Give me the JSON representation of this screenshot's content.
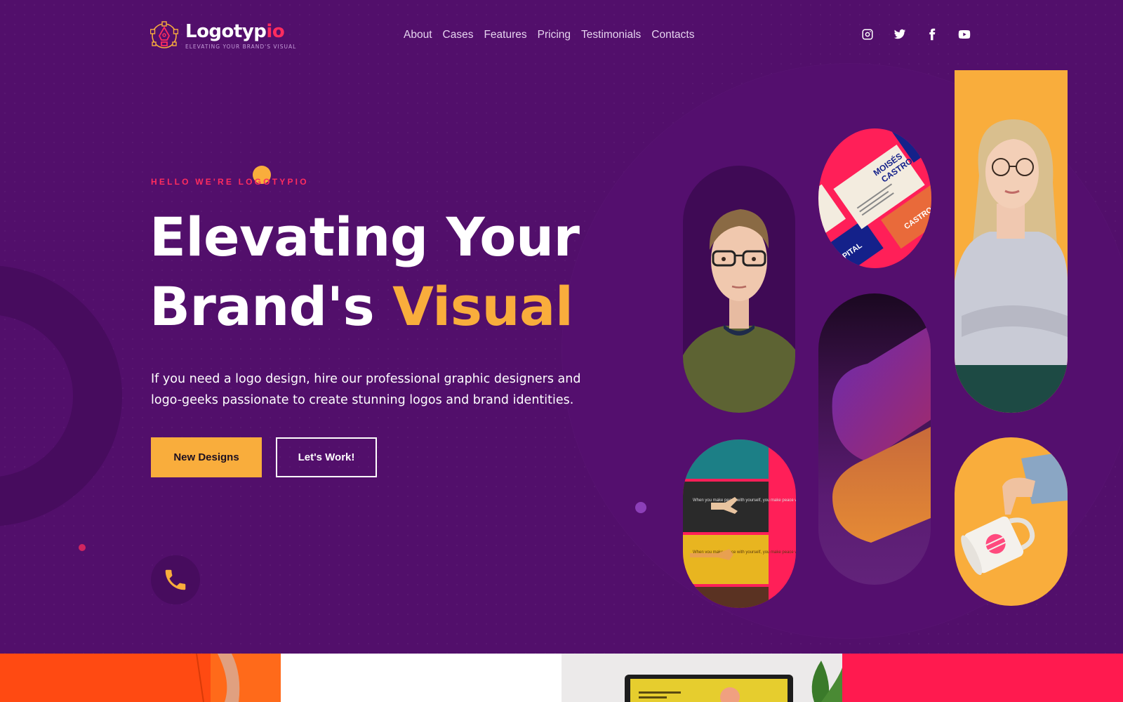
{
  "brand": {
    "name_main": "Logotyp",
    "name_accent": "io",
    "tagline": "ELEVATING YOUR BRAND'S VISUAL",
    "logo_icon": "pen-tool-icon"
  },
  "nav": {
    "items": [
      {
        "label": "About"
      },
      {
        "label": "Cases"
      },
      {
        "label": "Features"
      },
      {
        "label": "Pricing"
      },
      {
        "label": "Testimonials"
      },
      {
        "label": "Contacts"
      }
    ]
  },
  "social": [
    {
      "name": "instagram",
      "icon": "instagram-icon"
    },
    {
      "name": "twitter",
      "icon": "twitter-icon"
    },
    {
      "name": "facebook",
      "icon": "facebook-icon"
    },
    {
      "name": "youtube",
      "icon": "youtube-icon"
    }
  ],
  "hero": {
    "eyebrow": "HELLO WE'RE LOGOTYPIO",
    "headline_line1": "Elevating Your",
    "headline_line2_start": "Brand's ",
    "headline_line2_accent": "Visual",
    "description": "If you need a logo design, hire our professional graphic designers and logo-geeks passionate to create stunning logos and brand identities.",
    "primary_button": "New Designs",
    "secondary_button": "Let's Work!",
    "phone_icon": "phone-icon"
  },
  "collage": {
    "business_card_text": [
      "MOISÉS",
      "CASTRO"
    ],
    "business_card_labels": [
      "CAPITAL",
      "CASTRO CA"
    ],
    "can_text": "When you make peace with yourself, you make peace with the world"
  },
  "colors": {
    "background": "#520f6b",
    "accent_orange": "#f9ad3c",
    "accent_pink": "#ff2c5e",
    "text_light": "#e6d3ef"
  }
}
